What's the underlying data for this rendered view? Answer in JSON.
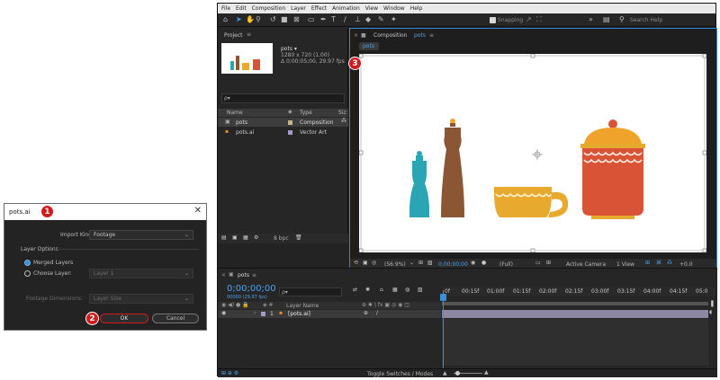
{
  "dialog": {
    "title": "pots.ai",
    "import_kind_label": "Import Kind:",
    "import_kind_value": "Footage",
    "layer_options_label": "Layer Options",
    "merged_layers_label": "Merged Layers",
    "choose_layer_label": "Choose Layer:",
    "choose_layer_value": "Layer 1",
    "footage_dimensions_label": "Footage Dimensions:",
    "footage_dimensions_value": "Layer Size",
    "ok_label": "OK",
    "cancel_label": "Cancel",
    "badge_1": "1",
    "badge_2": "2"
  },
  "menu": [
    "File",
    "Edit",
    "Composition",
    "Layer",
    "Effect",
    "Animation",
    "View",
    "Window",
    "Help"
  ],
  "toolbar": {
    "snapping_label": "Snapping",
    "search_help_placeholder": "Search Help"
  },
  "project": {
    "panel_title": "Project",
    "comp_name": "pots ▾",
    "comp_info_1": "1280 x 720 (1.00)",
    "comp_info_2": "Δ 0;00;05;00, 29.97 fps",
    "search_prefix": "ρ▾",
    "col_name": "Name",
    "col_type": "Type",
    "col_size": "Siz",
    "items": [
      {
        "name": "pots",
        "type": "Composition"
      },
      {
        "name": "pots.ai",
        "type": "Vector Art"
      }
    ],
    "bpc_label": "8 bpc"
  },
  "composition": {
    "panel_title": "Composition",
    "comp_name": "pots",
    "tab_label": "pots",
    "badge_3": "3",
    "zoom": "(56.9%)",
    "timecode": "0;00;00;00",
    "resolution": "(Full)",
    "camera": "Active Camera",
    "view": "1 View",
    "offset": "+0.0"
  },
  "timeline": {
    "comp_tab": "pots",
    "timecode": "0;00;00;00",
    "frame_info": "00000 (29.97 fps)",
    "search_prefix": "ρ▾",
    "layer_name_col": "Layer Name",
    "layer_index": "1",
    "layer_name": "[pots.ai]",
    "toggle_label": "Toggle Switches / Modes",
    "ruler": [
      "0f",
      "00:15f",
      "01:00f",
      "01:15f",
      "02:00f",
      "02:15f",
      "03:00f",
      "03:15f",
      "04:00f",
      "04:15f",
      "05:0"
    ]
  },
  "colors": {
    "teal": "#2aa5b5",
    "brown": "#8b5634",
    "yellow": "#e8aa2e",
    "red": "#d95436",
    "orange": "#f0a32a",
    "accent_blue": "#2e88d8",
    "badge_red": "#d01c1c"
  }
}
